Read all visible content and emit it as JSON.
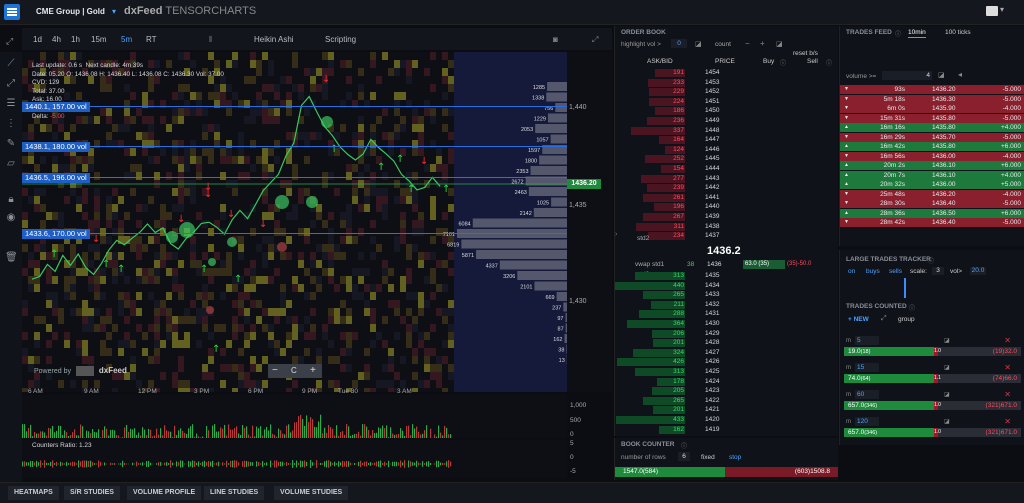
{
  "topbar": {
    "instrument": "CME Group | Gold",
    "brand_dx": "dxFeed",
    "brand_name": "TENSORCHARTS"
  },
  "chart_toolbar": {
    "timeframes": [
      "1d",
      "4h",
      "1h",
      "15m",
      "5m",
      "RT"
    ],
    "active_timeframe": "5m",
    "heikin": "Heikin Ashi",
    "scripting": "Scripting"
  },
  "chart_info": {
    "last_update": "Last update: 0.6 s",
    "next_candle": "Next candle: 4m 39s",
    "ohlc": "Date: 05.20  O: 1436.08  H: 1436.40  L: 1436.08  C: 1436.30  Vol: 37.00",
    "cvd": "CVD: 129",
    "total": "Total: 37.00",
    "ask": "Ask: 16.00",
    "bid": "Bid: 21.00",
    "delta_label": "Delta:",
    "delta_value": "-5.00"
  },
  "level_labels": [
    "1440.1, 157.00 vol",
    "1438.1, 180.00 vol",
    "1436.5, 196.00 vol",
    "1433.6, 170.00 vol"
  ],
  "price_scale": {
    "ticks": [
      "1,440",
      "1,435",
      "1,430"
    ],
    "current": "1436.20"
  },
  "volume_profile_values": [
    "1285",
    "1338",
    "756",
    "1229",
    "2053",
    "1057",
    "1597",
    "1800",
    "2353",
    "2672",
    "2463",
    "1025",
    "2142",
    "6084",
    "7101",
    "6819",
    "5871",
    "4337",
    "3206",
    "2101",
    "669",
    "237",
    "97",
    "87",
    "162",
    "38",
    "13"
  ],
  "time_axis": [
    "6 AM",
    "9 AM",
    "12 PM",
    "3 PM",
    "6 PM",
    "9 PM",
    "Tue 30",
    "3 AM"
  ],
  "volume_scale": [
    "1,000",
    "500",
    "0"
  ],
  "counters_scale": [
    "5",
    "0",
    "-5"
  ],
  "counters_label": "Counters Ratio:",
  "counters_value": "1.23",
  "powered_by": "Powered by",
  "powered_brand": "dxFeed",
  "zoom": {
    "minus": "−",
    "reset": "C",
    "plus": "+"
  },
  "order_book": {
    "title": "ORDER BOOK",
    "highlight": "highlight vol >",
    "highlight_value": "0",
    "count": "count",
    "reset": "reset b/s",
    "col_askbid": "ASK/BID",
    "col_price": "PRICE",
    "col_buy": "Buy",
    "col_sell": "Sell",
    "std_label": "std2",
    "vwap_label": "vwap std1",
    "vwap_qty": "38",
    "vwap_price": "1436",
    "vwap_buy": "63.0",
    "vwap_buy_n": "(35)",
    "vwap_sell_n": "(35)",
    "vwap_sell": "-50.0",
    "std_lower": "std2",
    "mid_price": "1436.2",
    "asks": [
      {
        "q": "191",
        "p": "1454"
      },
      {
        "q": "233",
        "p": "1453"
      },
      {
        "q": "229",
        "p": "1452"
      },
      {
        "q": "224",
        "p": "1451"
      },
      {
        "q": "186",
        "p": "1450"
      },
      {
        "q": "236",
        "p": "1449"
      },
      {
        "q": "337",
        "p": "1448"
      },
      {
        "q": "164",
        "p": "1447"
      },
      {
        "q": "124",
        "p": "1446"
      },
      {
        "q": "252",
        "p": "1445"
      },
      {
        "q": "154",
        "p": "1444"
      },
      {
        "q": "277",
        "p": "1443"
      },
      {
        "q": "239",
        "p": "1442"
      },
      {
        "q": "261",
        "p": "1441"
      },
      {
        "q": "196",
        "p": "1440"
      },
      {
        "q": "267",
        "p": "1439"
      },
      {
        "q": "311",
        "p": "1438"
      },
      {
        "q": "234",
        "p": "1437"
      }
    ],
    "bids": [
      {
        "q": "313",
        "p": "1435"
      },
      {
        "q": "440",
        "p": "1434"
      },
      {
        "q": "265",
        "p": "1433"
      },
      {
        "q": "211",
        "p": "1432"
      },
      {
        "q": "288",
        "p": "1431"
      },
      {
        "q": "364",
        "p": "1430"
      },
      {
        "q": "206",
        "p": "1429"
      },
      {
        "q": "201",
        "p": "1428"
      },
      {
        "q": "324",
        "p": "1427"
      },
      {
        "q": "426",
        "p": "1426"
      },
      {
        "q": "313",
        "p": "1425"
      },
      {
        "q": "178",
        "p": "1424"
      },
      {
        "q": "205",
        "p": "1423"
      },
      {
        "q": "265",
        "p": "1422"
      },
      {
        "q": "201",
        "p": "1421"
      },
      {
        "q": "433",
        "p": "1420"
      },
      {
        "q": "162",
        "p": "1419"
      }
    ]
  },
  "book_counter": {
    "title": "BOOK COUNTER",
    "rows_label": "number of rows",
    "rows_value": "6",
    "fixed": "fixed",
    "stop": "stop",
    "buy_val": "1547.0",
    "buy_n": "(584)",
    "sell_n": "(603)",
    "sell_val": "1508.8"
  },
  "trades_feed": {
    "title": "TRADES FEED",
    "tab1": "10min",
    "tab2": "100 ticks",
    "filter": "volume >=",
    "filter_value": "4",
    "rows": [
      {
        "t": "93s",
        "p": "1436.20",
        "v": "-5.000",
        "s": "sell"
      },
      {
        "t": "5m 18s",
        "p": "1436.30",
        "v": "-5.000",
        "s": "sell"
      },
      {
        "t": "6m 0s",
        "p": "1435.90",
        "v": "-4.000",
        "s": "sell"
      },
      {
        "t": "15m 31s",
        "p": "1435.80",
        "v": "-5.000",
        "s": "sell"
      },
      {
        "t": "16m 16s",
        "p": "1435.80",
        "v": "+4.000",
        "s": "buy"
      },
      {
        "t": "16m 29s",
        "p": "1435.70",
        "v": "-5.000",
        "s": "sell"
      },
      {
        "t": "16m 42s",
        "p": "1435.80",
        "v": "+6.000",
        "s": "buy"
      },
      {
        "t": "16m 56s",
        "p": "1436.00",
        "v": "-4.000",
        "s": "sell"
      },
      {
        "t": "20m 2s",
        "p": "1436.10",
        "v": "+6.000",
        "s": "buy"
      },
      {
        "t": "20m 7s",
        "p": "1436.10",
        "v": "+4.000",
        "s": "buy"
      },
      {
        "t": "20m 32s",
        "p": "1436.00",
        "v": "+5.000",
        "s": "buy"
      },
      {
        "t": "25m 48s",
        "p": "1436.20",
        "v": "-4.000",
        "s": "sell"
      },
      {
        "t": "28m 30s",
        "p": "1436.40",
        "v": "-5.000",
        "s": "sell"
      },
      {
        "t": "28m 36s",
        "p": "1436.50",
        "v": "+6.000",
        "s": "buy"
      },
      {
        "t": "28m 42s",
        "p": "1436.40",
        "v": "-5.000",
        "s": "sell"
      }
    ]
  },
  "large_trades": {
    "title": "LARGE TRADES TRACKER",
    "on": "on",
    "buys": "buys",
    "sells": "sells",
    "scale_label": "scale:",
    "scale_value": "3",
    "vol_label": "vol>",
    "vol_value": "20.0"
  },
  "trades_counted": {
    "title": "TRADES COUNTED",
    "new": "+ NEW",
    "group": "group",
    "m": "m",
    "items": [
      {
        "period": "5",
        "buy": "19.0",
        "buy_n": "(18)",
        "mid": "1.0",
        "sell_n": "(19)",
        "sell": "32.0"
      },
      {
        "period": "15",
        "buy": "74.0",
        "buy_n": "(64)",
        "mid": "1.1",
        "sell_n": "(74)",
        "sell": "66.0"
      },
      {
        "period": "60",
        "buy": "657.0",
        "buy_n": "(346)",
        "mid": "1.0",
        "sell_n": "(321)",
        "sell": "671.0"
      },
      {
        "period": "120",
        "buy": "657.0",
        "buy_n": "(346)",
        "mid": "1.0",
        "sell_n": "(321)",
        "sell": "671.0"
      }
    ]
  },
  "bottom_tabs": [
    "HEATMAPS",
    "S/R STUDIES",
    "VOLUME PROFILE",
    "LINE STUDIES",
    "VOLUME STUDIES"
  ],
  "colors": {
    "ask": "#ff4b5c",
    "bid": "#39d46a",
    "accent": "#4aa3ff",
    "level": "#1f5fc4"
  }
}
